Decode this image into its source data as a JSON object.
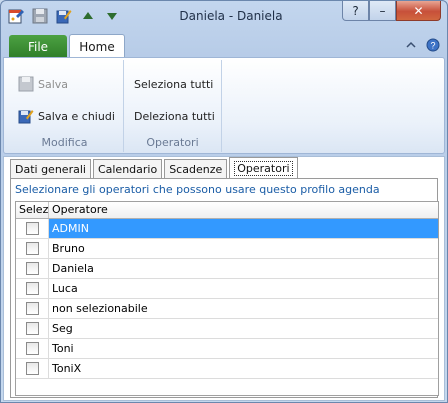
{
  "window": {
    "title": "Daniela - Daniela"
  },
  "title_buttons": {
    "help": "?",
    "minimize": "–",
    "close": "✕"
  },
  "ribbon_tabs": {
    "file": "File",
    "home": "Home"
  },
  "ribbon": {
    "groups": [
      {
        "label": "Modifica",
        "buttons": [
          {
            "label": "Salva",
            "enabled": false
          },
          {
            "label": "Salva e chiudi",
            "enabled": true
          }
        ]
      },
      {
        "label": "Operatori",
        "buttons": [
          {
            "label": "Seleziona tutti"
          },
          {
            "label": "Deleziona tutti"
          }
        ]
      }
    ]
  },
  "tabs": [
    "Dati generali",
    "Calendario",
    "Scadenze",
    "Operatori"
  ],
  "active_tab": "Operatori",
  "operatori": {
    "hint": "Selezionare gli operatori che possono usare questo profilo agenda",
    "columns": {
      "select": "Selezionato",
      "operator": "Operatore"
    },
    "rows": [
      {
        "name": "ADMIN",
        "selected_row": true,
        "checked": false
      },
      {
        "name": "Bruno",
        "selected_row": false,
        "checked": false
      },
      {
        "name": "Daniela",
        "selected_row": false,
        "checked": false
      },
      {
        "name": "Luca",
        "selected_row": false,
        "checked": false
      },
      {
        "name": "non selezionabile",
        "selected_row": false,
        "checked": false
      },
      {
        "name": "Seg",
        "selected_row": false,
        "checked": false
      },
      {
        "name": "Toni",
        "selected_row": false,
        "checked": false
      },
      {
        "name": "ToniX",
        "selected_row": false,
        "checked": false
      }
    ]
  },
  "colors": {
    "file_tab": "#3a8f33",
    "selection": "#3399ff",
    "hint_text": "#1b5da6",
    "close_button": "#c7503a"
  },
  "icons": [
    "app-icon",
    "save-icon",
    "save-close-icon",
    "arrow-up-icon",
    "arrow-down-icon",
    "collapse-ribbon-icon",
    "help-icon"
  ]
}
